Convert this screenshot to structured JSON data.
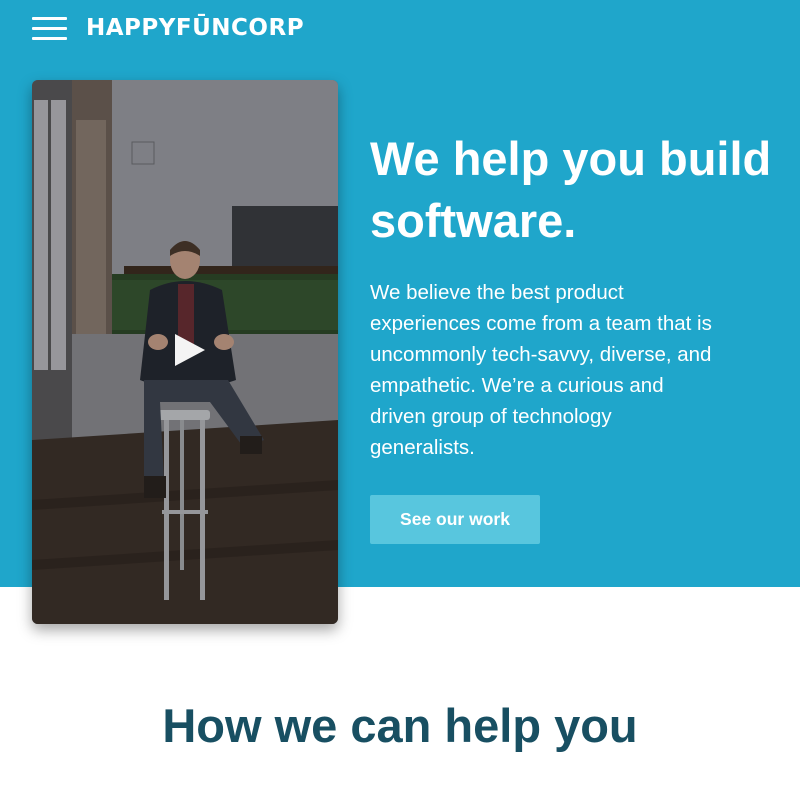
{
  "header": {
    "logo_text": "HAPPYFŪNCORP",
    "menu_icon": "hamburger-menu-icon"
  },
  "hero": {
    "headline": "We help you build software.",
    "body": "We believe the best product experiences come from a team that is uncommonly tech-savvy, diverse, and empathetic. We’re a curious and driven group of technology generalists.",
    "cta_label": "See our work",
    "video_play_icon": "play-icon"
  },
  "section": {
    "title": "How we can help you"
  },
  "colors": {
    "hero_background": "#1fa6cb",
    "button_background": "#58c6de",
    "section_title": "#184f62"
  }
}
